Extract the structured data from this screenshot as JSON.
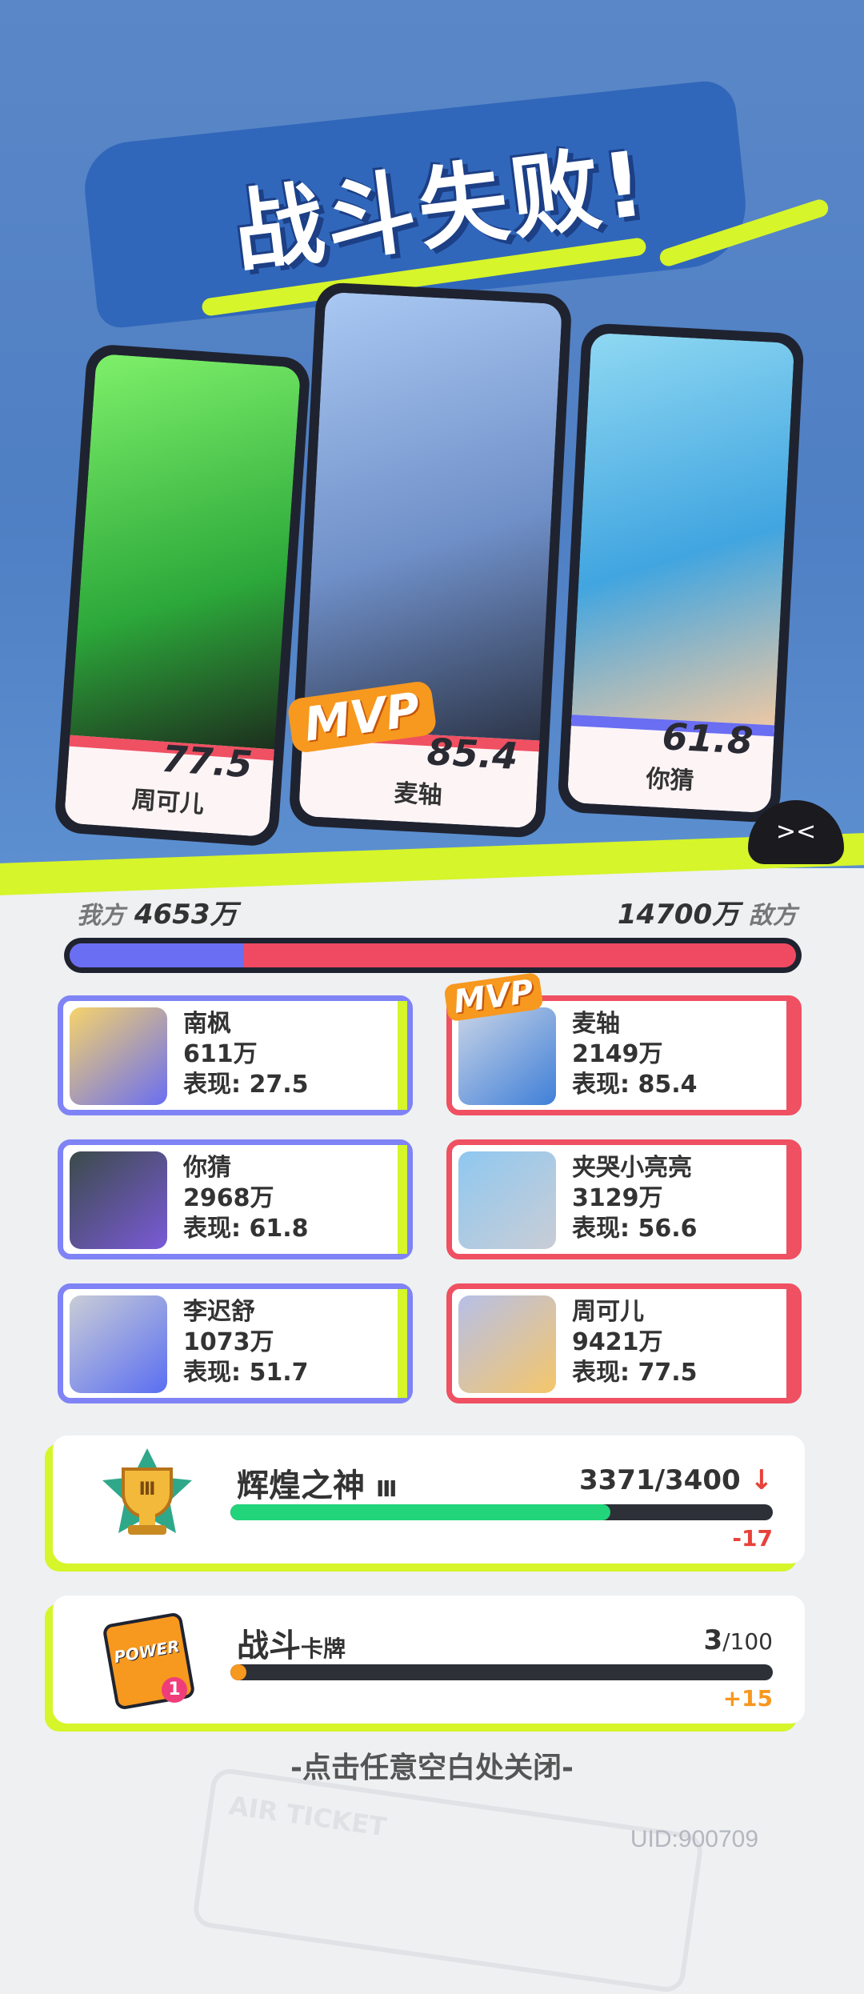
{
  "header": {
    "title": "战斗失败!"
  },
  "top_cards": [
    {
      "name": "周可儿",
      "score": "77.5",
      "mvp": false
    },
    {
      "name": "麦轴",
      "score": "85.4",
      "mvp": true
    },
    {
      "name": "你猜",
      "score": "61.8",
      "mvp": false
    }
  ],
  "mvp_label": "MVP",
  "totals": {
    "ours_label": "我方",
    "ours_value": "4653万",
    "enemy_value": "14700万",
    "enemy_label": "敌方",
    "ours_share": 0.2405
  },
  "players_left": [
    {
      "name": "南枫",
      "damage": "611万",
      "perf": "表现: 27.5"
    },
    {
      "name": "你猜",
      "damage": "2968万",
      "perf": "表现: 61.8"
    },
    {
      "name": "李迟舒",
      "damage": "1073万",
      "perf": "表现: 51.7"
    }
  ],
  "players_right": [
    {
      "name": "麦轴",
      "damage": "2149万",
      "perf": "表现: 85.4",
      "mvp": true
    },
    {
      "name": "夹哭小亮亮",
      "damage": "3129万",
      "perf": "表现: 56.6"
    },
    {
      "name": "周可儿",
      "damage": "9421万",
      "perf": "表现: 77.5"
    }
  ],
  "rank": {
    "title": "辉煌之神",
    "tier": "Ⅲ",
    "value": "3371/3400",
    "progress": 0.7,
    "delta": "-17",
    "bar_color": "#22d47a",
    "delta_color": "#e8413a"
  },
  "cards": {
    "title": "战斗",
    "title_small": "卡牌",
    "value_main": "3",
    "value_total": "/100",
    "progress": 0.03,
    "delta": "+15",
    "icon_text": "POWER",
    "icon_badge": "1",
    "bar_color": "#f7981f",
    "delta_color": "#f7981f"
  },
  "close_hint": "-点击任意空白处关闭-",
  "uid": "UID:900709",
  "ticket_text": "AIR TICKET"
}
